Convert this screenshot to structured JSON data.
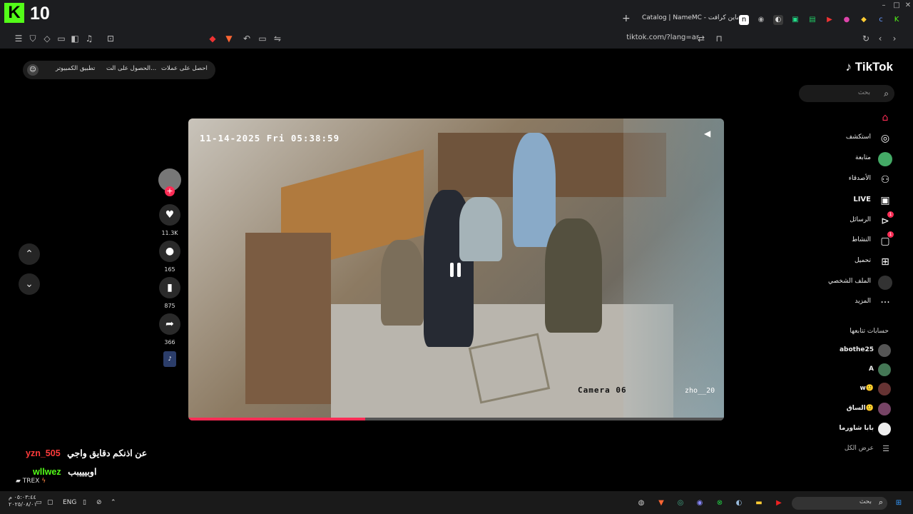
{
  "stream_overlay": {
    "logo_letter": "K",
    "viewer_count": "10"
  },
  "browser": {
    "active_tab_title": "Catalog | NameMC - جلود ماين كرافت",
    "address": "tiktok.com/?lang=ar"
  },
  "tiktok": {
    "logo": "TikTok",
    "search_placeholder": "بحث",
    "top_pill": {
      "get_coins": "احصل على عملات",
      "get_app": "الحصول على الت...",
      "pc_app": "تطبيق الكمبيوتر"
    },
    "nav": [
      {
        "label": "",
        "icon": "home-icon"
      },
      {
        "label": "استكشف",
        "icon": "compass-icon"
      },
      {
        "label": "متابعة",
        "icon": "following-icon"
      },
      {
        "label": "الأصدقاء",
        "icon": "friends-icon"
      },
      {
        "label": "LIVE",
        "icon": "live-icon"
      },
      {
        "label": "الرسائل",
        "icon": "messages-icon",
        "badge": "1"
      },
      {
        "label": "النشاط",
        "icon": "activity-icon",
        "badge": "1"
      },
      {
        "label": "تحميل",
        "icon": "upload-icon"
      },
      {
        "label": "الملف الشخصي",
        "icon": "profile-icon"
      },
      {
        "label": "المزيد",
        "icon": "more-icon"
      }
    ],
    "following_header": "حسابات تتابعها",
    "following": [
      {
        "name": "abothe25"
      },
      {
        "name": "A"
      },
      {
        "name": "w🙂"
      },
      {
        "name": "الساق🙂"
      },
      {
        "name": "بابا شاورما"
      },
      {
        "name": "عرض الكل"
      }
    ],
    "video": {
      "timestamp": "11-14-2025 Fri 05:38:59",
      "camera_label": "Camera 06",
      "watermark": "zho__20",
      "progress": 0.33
    },
    "actions": {
      "likes": "11.3K",
      "comments": "165",
      "bookmarks": "875",
      "shares": "366"
    }
  },
  "chat": [
    {
      "user": "yzn_505",
      "message": "عن اذنكم دقايق واجي",
      "color": "#ff3b3b"
    },
    {
      "user": "wllwez",
      "message": "اوبيييبب",
      "color": "#53fc18"
    }
  ],
  "chat_footer": "TREX",
  "taskbar": {
    "search_placeholder": "بحث",
    "lang": "ENG",
    "time": "٠٥:٠٣:٤٤ م",
    "date": "٢٠٢٥/٠٨/٠١"
  }
}
